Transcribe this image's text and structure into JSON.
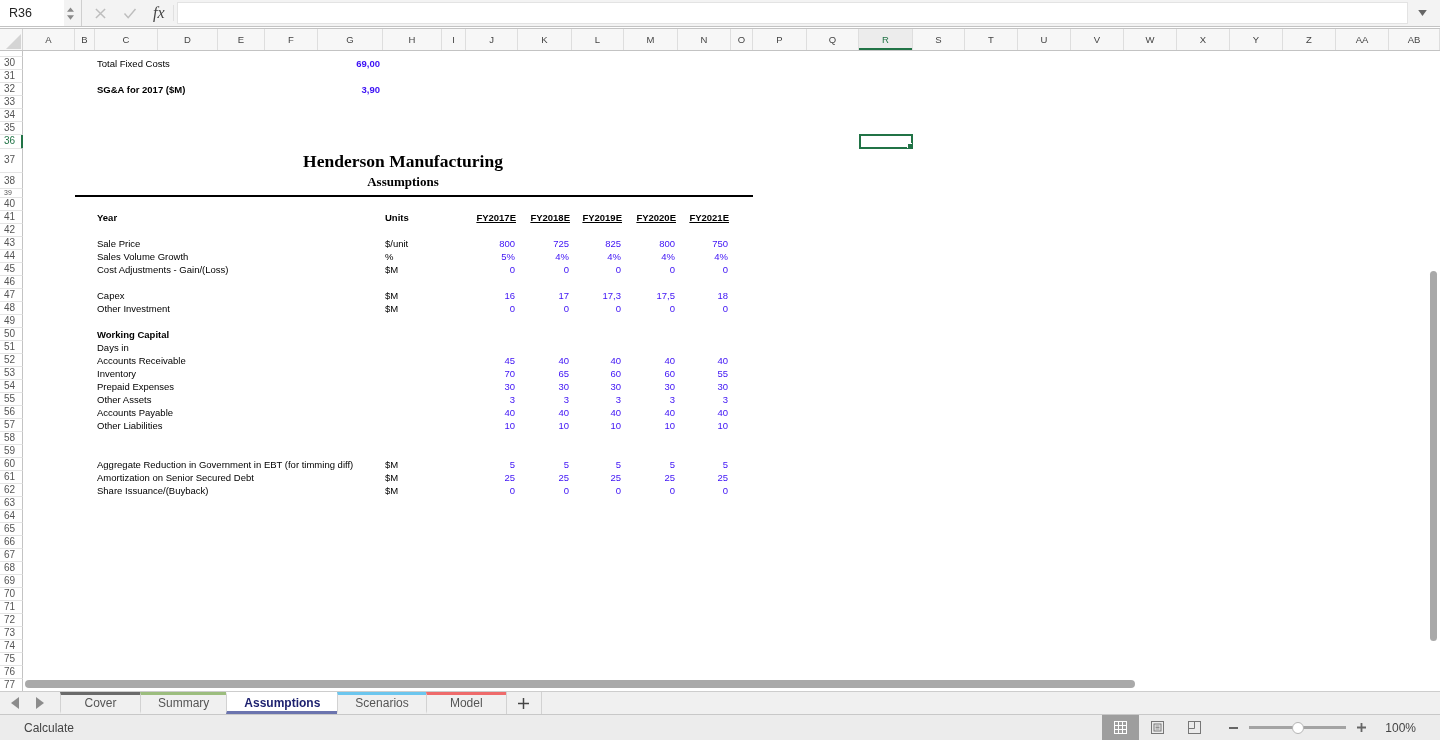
{
  "name_box": {
    "value": "R36"
  },
  "formula_bar": {
    "label": "fx"
  },
  "columns": [
    {
      "label": "A",
      "selected": false
    },
    {
      "label": "B",
      "selected": false
    },
    {
      "label": "C",
      "selected": false
    },
    {
      "label": "D",
      "selected": false
    },
    {
      "label": "E",
      "selected": false
    },
    {
      "label": "F",
      "selected": false
    },
    {
      "label": "G",
      "selected": false
    },
    {
      "label": "H",
      "selected": false
    },
    {
      "label": "I",
      "selected": false
    },
    {
      "label": "J",
      "selected": false
    },
    {
      "label": "K",
      "selected": false
    },
    {
      "label": "L",
      "selected": false
    },
    {
      "label": "M",
      "selected": false
    },
    {
      "label": "N",
      "selected": false
    },
    {
      "label": "O",
      "selected": false
    },
    {
      "label": "P",
      "selected": false
    },
    {
      "label": "Q",
      "selected": false
    },
    {
      "label": "R",
      "selected": true
    },
    {
      "label": "S",
      "selected": false
    },
    {
      "label": "T",
      "selected": false
    },
    {
      "label": "U",
      "selected": false
    },
    {
      "label": "V",
      "selected": false
    },
    {
      "label": "W",
      "selected": false
    },
    {
      "label": "X",
      "selected": false
    },
    {
      "label": "Y",
      "selected": false
    },
    {
      "label": "Z",
      "selected": false
    },
    {
      "label": "AA",
      "selected": false
    },
    {
      "label": "AB",
      "selected": false
    }
  ],
  "rows": [
    {
      "number": "30",
      "selected": false,
      "kind": "total",
      "label": "Total Fixed Costs",
      "value": "69,00"
    },
    {
      "number": "31",
      "selected": false,
      "kind": "blank"
    },
    {
      "number": "32",
      "selected": false,
      "kind": "key-figure",
      "label": "SG&A for 2017 ($M)",
      "value": "3,90"
    },
    {
      "number": "33",
      "selected": false,
      "kind": "blank"
    },
    {
      "number": "34",
      "selected": false,
      "kind": "blank"
    },
    {
      "number": "35",
      "selected": false,
      "kind": "blank"
    },
    {
      "number": "36",
      "selected": true,
      "kind": "blank"
    },
    {
      "number": "37",
      "selected": false,
      "kind": "title",
      "text": "Henderson Manufacturing"
    },
    {
      "number": "38",
      "selected": false,
      "kind": "subtitle",
      "text": "Assumptions"
    },
    {
      "number": "39",
      "selected": false,
      "kind": "rule"
    },
    {
      "number": "40",
      "selected": false,
      "kind": "blank"
    },
    {
      "number": "41",
      "selected": false,
      "kind": "header",
      "label": "Year",
      "unit": "Units",
      "values": [
        "FY2017E",
        "FY2018E",
        "FY2019E",
        "FY2020E",
        "FY2021E"
      ]
    },
    {
      "number": "42",
      "selected": false,
      "kind": "blank"
    },
    {
      "number": "43",
      "selected": false,
      "kind": "data",
      "label": "Sale Price",
      "unit": "$/unit",
      "values": [
        "800",
        "725",
        "825",
        "800",
        "750"
      ]
    },
    {
      "number": "44",
      "selected": false,
      "kind": "data",
      "label": "Sales Volume Growth",
      "unit": "%",
      "values": [
        "5%",
        "4%",
        "4%",
        "4%",
        "4%"
      ]
    },
    {
      "number": "45",
      "selected": false,
      "kind": "data",
      "label": "Cost Adjustments - Gain/(Loss)",
      "unit": "$M",
      "values": [
        "0",
        "0",
        "0",
        "0",
        "0"
      ]
    },
    {
      "number": "46",
      "selected": false,
      "kind": "blank"
    },
    {
      "number": "47",
      "selected": false,
      "kind": "data",
      "label": "Capex",
      "unit": "$M",
      "values": [
        "16",
        "17",
        "17,3",
        "17,5",
        "18"
      ]
    },
    {
      "number": "48",
      "selected": false,
      "kind": "data",
      "label": "Other Investment",
      "unit": "$M",
      "values": [
        "0",
        "0",
        "0",
        "0",
        "0"
      ]
    },
    {
      "number": "49",
      "selected": false,
      "kind": "blank"
    },
    {
      "number": "50",
      "selected": false,
      "kind": "section",
      "label": "Working Capital"
    },
    {
      "number": "51",
      "selected": false,
      "kind": "data",
      "label": "Days in"
    },
    {
      "number": "52",
      "selected": false,
      "kind": "data",
      "label": "Accounts Receivable",
      "values": [
        "45",
        "40",
        "40",
        "40",
        "40"
      ]
    },
    {
      "number": "53",
      "selected": false,
      "kind": "data",
      "label": "Inventory",
      "values": [
        "70",
        "65",
        "60",
        "60",
        "55"
      ]
    },
    {
      "number": "54",
      "selected": false,
      "kind": "data",
      "label": "Prepaid Expenses",
      "values": [
        "30",
        "30",
        "30",
        "30",
        "30"
      ]
    },
    {
      "number": "55",
      "selected": false,
      "kind": "data",
      "label": "Other Assets",
      "values": [
        "3",
        "3",
        "3",
        "3",
        "3"
      ]
    },
    {
      "number": "56",
      "selected": false,
      "kind": "data",
      "label": "Accounts Payable",
      "values": [
        "40",
        "40",
        "40",
        "40",
        "40"
      ]
    },
    {
      "number": "57",
      "selected": false,
      "kind": "data",
      "label": "Other Liabilities",
      "values": [
        "10",
        "10",
        "10",
        "10",
        "10"
      ]
    },
    {
      "number": "58",
      "selected": false,
      "kind": "blank"
    },
    {
      "number": "59",
      "selected": false,
      "kind": "blank"
    },
    {
      "number": "60",
      "selected": false,
      "kind": "data",
      "label": "Aggregate Reduction in Government in EBT (for timming diff)",
      "unit": "$M",
      "values": [
        "5",
        "5",
        "5",
        "5",
        "5"
      ]
    },
    {
      "number": "61",
      "selected": false,
      "kind": "data",
      "label": "Amortization on Senior Secured Debt",
      "unit": "$M",
      "values": [
        "25",
        "25",
        "25",
        "25",
        "25"
      ]
    },
    {
      "number": "62",
      "selected": false,
      "kind": "data",
      "label": "Share Issuance/(Buyback)",
      "unit": "$M",
      "values": [
        "0",
        "0",
        "0",
        "0",
        "0"
      ]
    },
    {
      "number": "63",
      "selected": false,
      "kind": "blank"
    },
    {
      "number": "64",
      "selected": false,
      "kind": "blank"
    },
    {
      "number": "65",
      "selected": false,
      "kind": "blank"
    },
    {
      "number": "66",
      "selected": false,
      "kind": "blank"
    },
    {
      "number": "67",
      "selected": false,
      "kind": "blank"
    },
    {
      "number": "68",
      "selected": false,
      "kind": "blank"
    },
    {
      "number": "69",
      "selected": false,
      "kind": "blank"
    },
    {
      "number": "70",
      "selected": false,
      "kind": "blank"
    },
    {
      "number": "71",
      "selected": false,
      "kind": "blank"
    },
    {
      "number": "72",
      "selected": false,
      "kind": "blank"
    },
    {
      "number": "73",
      "selected": false,
      "kind": "blank"
    },
    {
      "number": "74",
      "selected": false,
      "kind": "blank"
    },
    {
      "number": "75",
      "selected": false,
      "kind": "blank"
    },
    {
      "number": "76",
      "selected": false,
      "kind": "blank"
    },
    {
      "number": "77",
      "selected": false,
      "kind": "blank"
    }
  ],
  "sheet_tabs": [
    {
      "label": "Cover",
      "selected": false,
      "color": "#6b6b6b"
    },
    {
      "label": "Summary",
      "selected": false,
      "color": "#9cbd7e"
    },
    {
      "label": "Assumptions",
      "selected": true,
      "color": "#6b74ae"
    },
    {
      "label": "Scenarios",
      "selected": false,
      "color": "#6cc6ee"
    },
    {
      "label": "Model",
      "selected": false,
      "color": "#ee6b6b"
    }
  ],
  "status_bar": {
    "mode": "Calculate",
    "view_buttons": [
      {
        "kind": "normal",
        "selected": true
      },
      {
        "kind": "page-layout",
        "selected": false
      },
      {
        "kind": "page-break",
        "selected": false
      }
    ],
    "zoom": {
      "level": 0.5,
      "reading": "100%"
    }
  }
}
